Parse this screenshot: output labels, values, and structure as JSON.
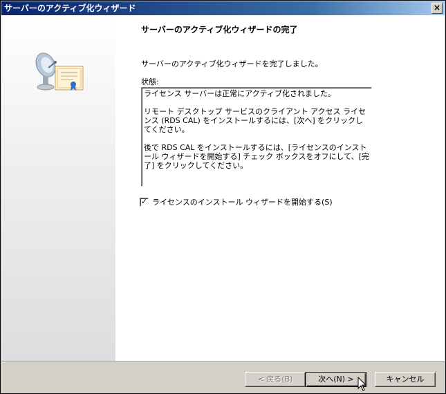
{
  "window": {
    "title": "サーバーのアクティブ化ウィザード",
    "close_label": "×"
  },
  "page": {
    "heading": "サーバーのアクティブ化ウィザードの完了",
    "description": "サーバーのアクティブ化ウィザードを完了しました。",
    "status_label": "状態:",
    "status_lines": [
      "ライセンス サーバーは正常にアクティブ化されました。",
      "リモート デスクトップ サービスのクライアント アクセス ライセンス (RDS CAL) をインストールするには、[次へ] をクリックしてください。",
      "後で RDS CAL をインストールするには、[ライセンスのインストール ウィザードを開始する] チェック ボックスをオフにして、[完了] をクリックしてください。"
    ],
    "checkbox": {
      "label": "ライセンスのインストール ウィザードを開始する(S)",
      "checked": true,
      "mark": "✓"
    }
  },
  "buttons": {
    "back": "< 戻る(B)",
    "next": "次へ(N) >",
    "cancel": "キャンセル"
  },
  "icons": {
    "wizard": "satellite-certificate-icon"
  },
  "colors": {
    "titlebar": "#0a246a",
    "face": "#d4d0c8"
  }
}
